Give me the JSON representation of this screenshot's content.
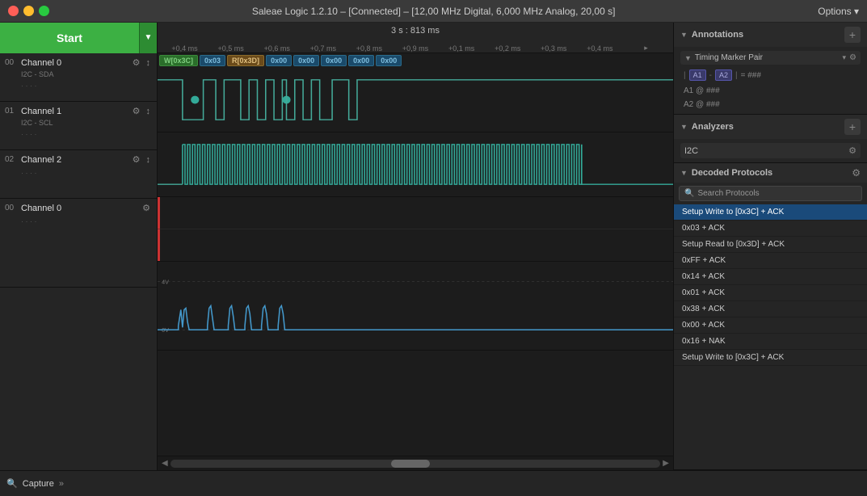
{
  "titlebar": {
    "title": "Saleae Logic 1.2.10 – [Connected] – [12,00 MHz Digital, 6,000 MHz Analog, 20,00 s]",
    "options_label": "Options ▾",
    "btn_close": "●",
    "btn_min": "●",
    "btn_max": "●"
  },
  "left": {
    "start_btn": "Start",
    "channels": [
      {
        "number": "00",
        "name": "Channel 0",
        "label": "I2C - SDA",
        "icons": [
          "⚙",
          "↕"
        ],
        "type": "digital"
      },
      {
        "number": "01",
        "name": "Channel 1",
        "label": "I2C - SCL",
        "icons": [
          "⚙",
          "↕"
        ],
        "type": "digital"
      },
      {
        "number": "02",
        "name": "Channel 2",
        "label": "",
        "icons": [
          "⚙",
          "↕"
        ],
        "type": "digital_empty"
      },
      {
        "number": "00",
        "name": "Channel 0",
        "label": "",
        "icons": [
          "⚙"
        ],
        "type": "analog"
      }
    ]
  },
  "waveform": {
    "time_center": "3 s : 813 ms",
    "time_ticks": [
      "+0,4 ms",
      "+0,5 ms",
      "+0,6 ms",
      "+0,7 ms",
      "+0,8 ms",
      "+0,9 ms",
      "+0,1 ms",
      "+0,2 ms",
      "+0,3 ms",
      "+0,4 ms"
    ],
    "protocol_chips": [
      {
        "label": "W[0x3C]",
        "type": "write"
      },
      {
        "label": "0x03",
        "type": "data"
      },
      {
        "label": "R[0x3D]",
        "type": "read"
      },
      {
        "label": "0x00",
        "type": "data"
      },
      {
        "label": "0x00",
        "type": "data"
      },
      {
        "label": "0x00",
        "type": "data"
      },
      {
        "label": "0x00",
        "type": "data"
      },
      {
        "label": "0x00",
        "type": "data"
      }
    ]
  },
  "right": {
    "annotations": {
      "title": "Annotations",
      "timing_marker": "Timing Marker Pair",
      "formula": "| A1 - A2 | = ###",
      "a1_line": "A1  @  ###",
      "a2_line": "A2  @  ###",
      "badges": {
        "a1": "A1",
        "a2": "A2"
      }
    },
    "analyzers": {
      "title": "Analyzers",
      "items": [
        {
          "name": "I2C"
        }
      ]
    },
    "decoded": {
      "title": "Decoded Protocols",
      "search_placeholder": "Search Protocols",
      "protocols": [
        {
          "label": "Setup Write to [0x3C] + ACK",
          "selected": true
        },
        {
          "label": "0x03 + ACK",
          "selected": false
        },
        {
          "label": "Setup Read to [0x3D] + ACK",
          "selected": false
        },
        {
          "label": "0xFF + ACK",
          "selected": false
        },
        {
          "label": "0x14 + ACK",
          "selected": false
        },
        {
          "label": "0x01 + ACK",
          "selected": false
        },
        {
          "label": "0x38 + ACK",
          "selected": false
        },
        {
          "label": "0x00 + ACK",
          "selected": false
        },
        {
          "label": "0x16 + NAK",
          "selected": false
        },
        {
          "label": "Setup Write to [0x3C] + ACK",
          "selected": false
        }
      ]
    }
  },
  "bottom": {
    "capture_label": "Capture",
    "arrows_label": "»"
  }
}
